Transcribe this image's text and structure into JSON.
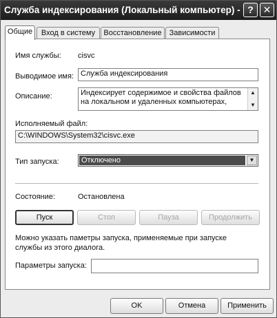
{
  "window": {
    "title": "Служба индексирования (Локальный компьютер) - ...",
    "help_label": "?",
    "close_label": "✕"
  },
  "tabs": [
    {
      "label": "Общие",
      "active": true
    },
    {
      "label": "Вход в систему",
      "active": false
    },
    {
      "label": "Восстановление",
      "active": false
    },
    {
      "label": "Зависимости",
      "active": false
    }
  ],
  "general": {
    "service_name_label": "Имя службы:",
    "service_name_value": "cisvc",
    "display_name_label": "Выводимое имя:",
    "display_name_value": "Служба индексирования",
    "description_label": "Описание:",
    "description_lines": [
      "Индексирует содержимое и свойства файлов",
      "на локальном и удаленных компьютерах,"
    ],
    "executable_label": "Исполняемый файл:",
    "executable_value": "C:\\WINDOWS\\System32\\cisvc.exe",
    "startup_type_label": "Тип запуска:",
    "startup_type_value": "Отключено",
    "status_label": "Состояние:",
    "status_value": "Остановлена",
    "buttons": {
      "start": "Пуск",
      "stop": "Стоп",
      "pause": "Пауза",
      "resume": "Продолжить"
    },
    "hint_line1": "Можно указать паметры запуска, применяемые при запуске",
    "hint_line2": "службы из этого диалога.",
    "params_label": "Параметры запуска:",
    "params_value": ""
  },
  "footer": {
    "ok": "OK",
    "cancel": "Отмена",
    "apply": "Применить"
  },
  "icons": {
    "scroll_up": "▲",
    "scroll_down": "▼",
    "dropdown": "▼"
  }
}
